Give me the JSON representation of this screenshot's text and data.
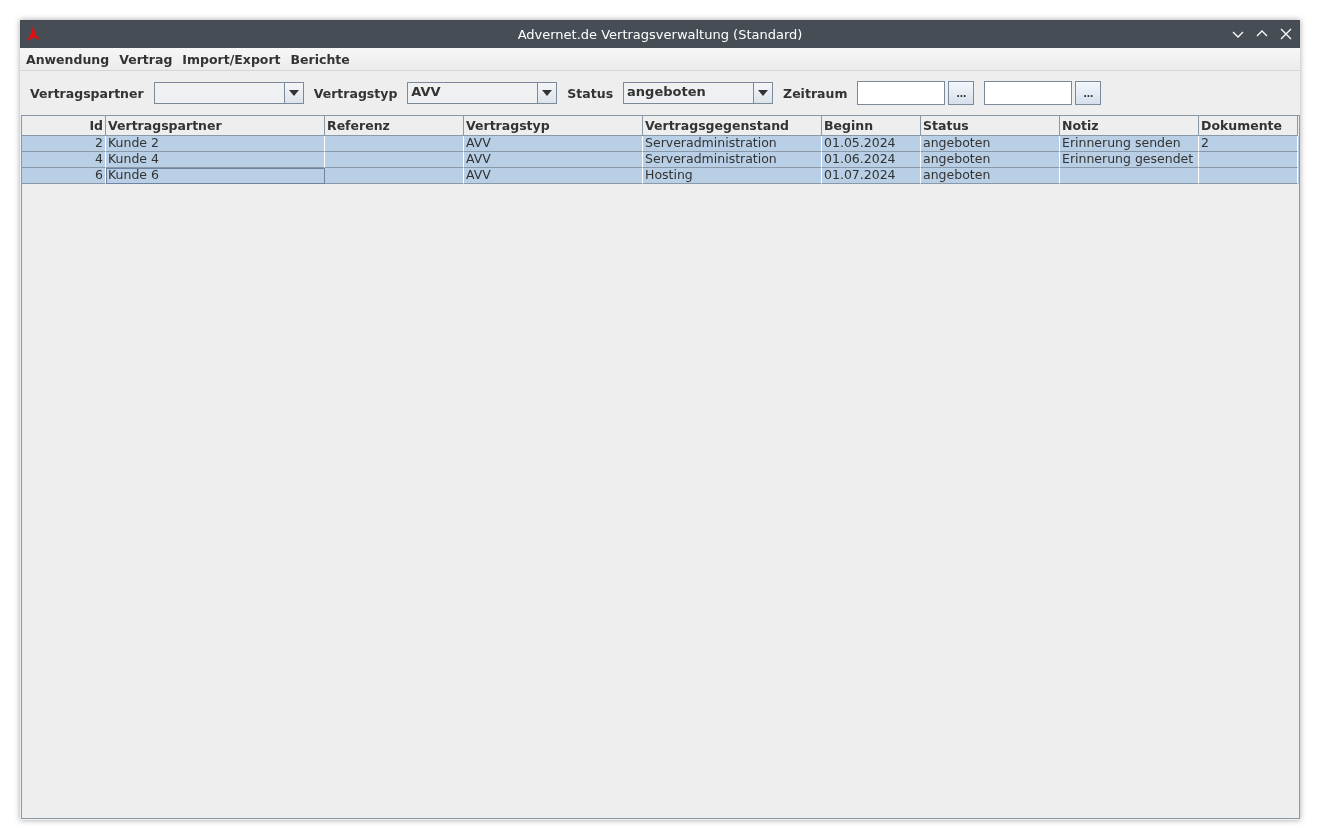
{
  "window": {
    "title": "Advernet.de Vertragsverwaltung (Standard)"
  },
  "menu": [
    "Anwendung",
    "Vertrag",
    "Import/Export",
    "Berichte"
  ],
  "filters": [
    {
      "kind": "combo",
      "label": "Vertragspartner"
    },
    {
      "kind": "combo",
      "label": "Vertragstyp",
      "value": "AVV"
    },
    {
      "kind": "combo",
      "label": "Status",
      "value": "angeboten"
    },
    {
      "kind": "range",
      "label": "Zeitraum",
      "button": "..."
    }
  ],
  "table": {
    "columns": [
      "Id",
      "Vertragspartner",
      "Referenz",
      "Vertragstyp",
      "Vertragsgegenstand",
      "Beginn",
      "Status",
      "Notiz",
      "Dokumente"
    ],
    "rows": [
      {
        "selected": true,
        "focused": false,
        "cells": [
          "2",
          "Kunde 2",
          "",
          "AVV",
          "Serveradministration",
          "01.05.2024",
          "angeboten",
          "Erinnerung senden",
          "2"
        ]
      },
      {
        "selected": true,
        "focused": false,
        "cells": [
          "4",
          "Kunde 4",
          "",
          "AVV",
          "Serveradministration",
          "01.06.2024",
          "angeboten",
          "Erinnerung gesendet",
          ""
        ]
      },
      {
        "selected": true,
        "focused": true,
        "cells": [
          "6",
          "Kunde 6",
          "",
          "AVV",
          "Hosting",
          "01.07.2024",
          "angeboten",
          "",
          ""
        ]
      }
    ]
  }
}
